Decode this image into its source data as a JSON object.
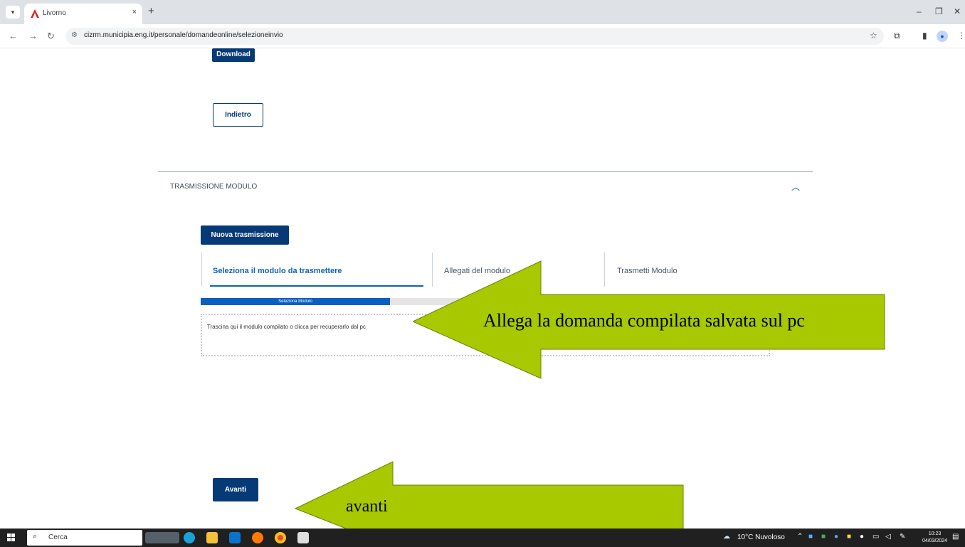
{
  "browser": {
    "tab_title": "Livorno",
    "tab_close": "×",
    "new_tab": "+",
    "url": "cizrm.municipia.eng.it/personale/domandeonline/selezioneinvio",
    "window_minimize": "–",
    "window_restore": "❐",
    "window_close": "✕"
  },
  "page": {
    "download_button": "Download",
    "back_button": "Indietro",
    "section_title": "TRASMISSIONE MODULO",
    "new_transmission_button": "Nuova trasmissione",
    "steps": [
      {
        "label": "Seleziona il modulo da trasmettere",
        "active": true
      },
      {
        "label": "Allegati del modulo",
        "active": false
      },
      {
        "label": "Trasmetti Modulo",
        "active": false
      }
    ],
    "progress": {
      "label": "Seleziona Modulo",
      "fraction": 0.333
    },
    "dropzone_text": "Trascina qui il modulo compilato o clicca per recuperarlo dal pc",
    "next_button": "Avanti"
  },
  "annotations": {
    "callout_main": "Allega la domanda compilata salvata sul pc",
    "callout_next": "avanti",
    "arrow_color": "#a8c800"
  },
  "taskbar": {
    "search_label": "Cerca",
    "weather": "10°C  Nuvoloso",
    "time": "10:23",
    "date": "04/03/2024"
  }
}
